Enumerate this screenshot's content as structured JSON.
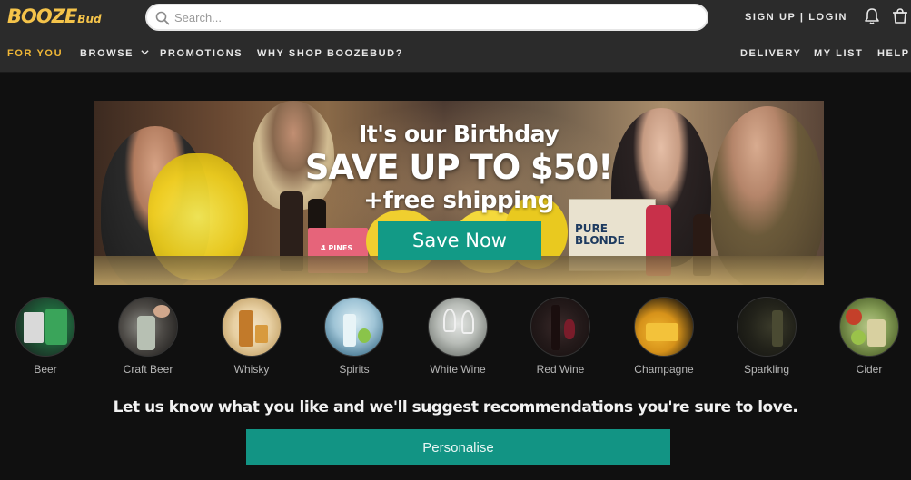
{
  "brand": {
    "logo_main": "BOOZE",
    "logo_sub": "Bud",
    "accent": "#f2b836",
    "teal": "#129a86"
  },
  "search": {
    "placeholder": "Search..."
  },
  "header": {
    "signup_login": "SIGN UP | LOGIN"
  },
  "nav_left": [
    {
      "label": "FOR YOU",
      "active": true
    },
    {
      "label": "BROWSE"
    },
    {
      "label": "PROMOTIONS"
    },
    {
      "label": "WHY SHOP BOOZEBUD?"
    }
  ],
  "nav_right": [
    {
      "label": "DELIVERY"
    },
    {
      "label": "MY LIST"
    },
    {
      "label": "HELP"
    }
  ],
  "banner": {
    "line1": "It's our Birthday",
    "line2": "SAVE UP TO $50!",
    "line3": "+free shipping",
    "cta": "Save Now",
    "box_label_1": "PURE",
    "box_label_2": "BLONDE",
    "pack_label": "4 PINES"
  },
  "categories": [
    {
      "label": "Beer"
    },
    {
      "label": "Craft Beer"
    },
    {
      "label": "Whisky"
    },
    {
      "label": "Spirits"
    },
    {
      "label": "White Wine"
    },
    {
      "label": "Red Wine"
    },
    {
      "label": "Champagne"
    },
    {
      "label": "Sparkling"
    },
    {
      "label": "Cider"
    }
  ],
  "promo_text": "Let us know what you like and we'll suggest recommendations you're sure to love.",
  "personalise_button": "Personalise"
}
